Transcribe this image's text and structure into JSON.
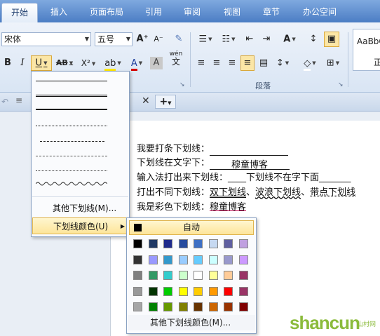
{
  "tabs": [
    {
      "label": "开始",
      "active": true
    },
    {
      "label": "插入"
    },
    {
      "label": "页面布局"
    },
    {
      "label": "引用"
    },
    {
      "label": "审阅"
    },
    {
      "label": "视图"
    },
    {
      "label": "章节"
    },
    {
      "label": "办公空间"
    }
  ],
  "font": {
    "name": "宋体",
    "size": "五号",
    "bold": "B",
    "italic": "I",
    "underline": "U",
    "strikethrough": "AB",
    "superscript": "X²",
    "grow": "A⁺",
    "shrink": "A⁻",
    "phonetic_top": "wén",
    "phonetic_bottom": "文"
  },
  "ribbon": {
    "paragraph_group_label": "段落",
    "style_preview": "AaBbC",
    "style_name": "正"
  },
  "document": {
    "lines": [
      {
        "text": "我要打条下划线："
      },
      {
        "prefix": "下划线在文字下：",
        "underlined": "穆童博客"
      },
      {
        "prefix": "输入法打出来下划线：____下划线不在字下面_______"
      },
      {
        "prefix": "打出不同下划线：",
        "double": "双下划线",
        "sep1": "、",
        "wavy": "波浪下划线",
        "sep2": "、",
        "dotted": "带点下划线"
      },
      {
        "prefix": "我是彩色下划线：",
        "colored": "穆童博客"
      }
    ]
  },
  "underline_menu": {
    "more_label": "其他下划线(M)...",
    "color_label": "下划线颜色(U)"
  },
  "color_menu": {
    "auto_label": "自动",
    "more_label": "其他下划线颜色(M)...",
    "rows": [
      [
        "#000000",
        "#1f3864",
        "#1e2a8c",
        "#264b9e",
        "#3d6fc4",
        "#c6d9f1",
        "#5f5fa0",
        "#c0a0e0"
      ],
      [
        "#333333",
        "#9999ff",
        "#3399cc",
        "#99ccff",
        "#66ccff",
        "#ccffff",
        "#9999cc",
        "#cc99ff"
      ],
      [
        "#808080",
        "#339966",
        "#33cccc",
        "#ccffcc",
        "#ffffff",
        "#ffff99",
        "#ffcc99",
        "#993366"
      ],
      [
        "#999999",
        "#003300",
        "#00cc00",
        "#ffff00",
        "#ffcc00",
        "#ff9900",
        "#ff0000",
        "#993366"
      ],
      [
        "#a6a6a6",
        "#008000",
        "#669900",
        "#808000",
        "#663300",
        "#cc6600",
        "#993300",
        "#800000"
      ]
    ]
  },
  "watermark": {
    "text": "shancun",
    "sub": "山村网"
  },
  "icons": [
    "undo-icon",
    "close-icon",
    "new-tab-icon",
    "highlight-icon",
    "font-color-icon",
    "paragraph-icon",
    "bullets-icon"
  ]
}
